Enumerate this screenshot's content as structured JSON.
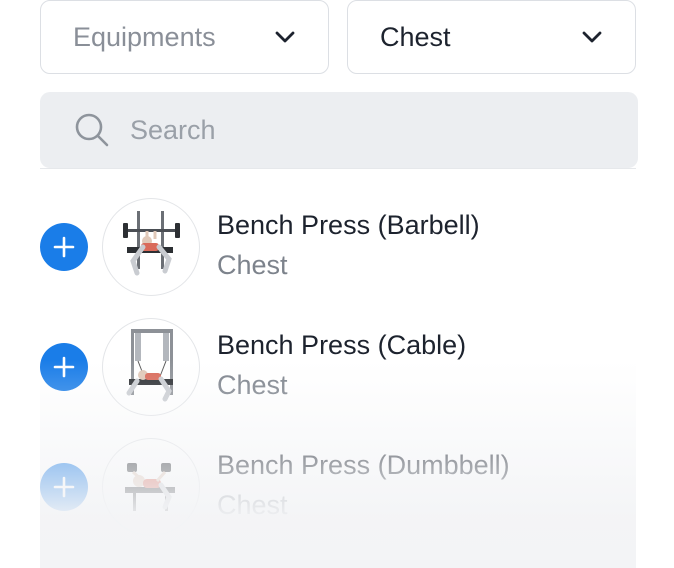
{
  "filters": {
    "equipment": {
      "label": "Equipments",
      "is_placeholder": true,
      "icon": "chevron-down-icon"
    },
    "muscle": {
      "label": "Chest",
      "is_placeholder": false,
      "icon": "chevron-down-icon"
    }
  },
  "search": {
    "placeholder": "Search",
    "value": "",
    "icon": "search-icon"
  },
  "colors": {
    "accent": "#1a7de8",
    "text_primary": "#1d232e",
    "text_secondary": "#7d838c",
    "search_bg": "#eceef1"
  },
  "exercises": [
    {
      "name": "Bench Press (Barbell)",
      "muscle": "Chest",
      "image": "barbell-bench-press-illustration",
      "add_icon": "plus-icon"
    },
    {
      "name": "Bench Press (Cable)",
      "muscle": "Chest",
      "image": "cable-bench-press-illustration",
      "add_icon": "plus-icon"
    },
    {
      "name": "Bench Press (Dumbbell)",
      "muscle": "Chest",
      "image": "dumbbell-bench-press-illustration",
      "add_icon": "plus-icon"
    }
  ]
}
